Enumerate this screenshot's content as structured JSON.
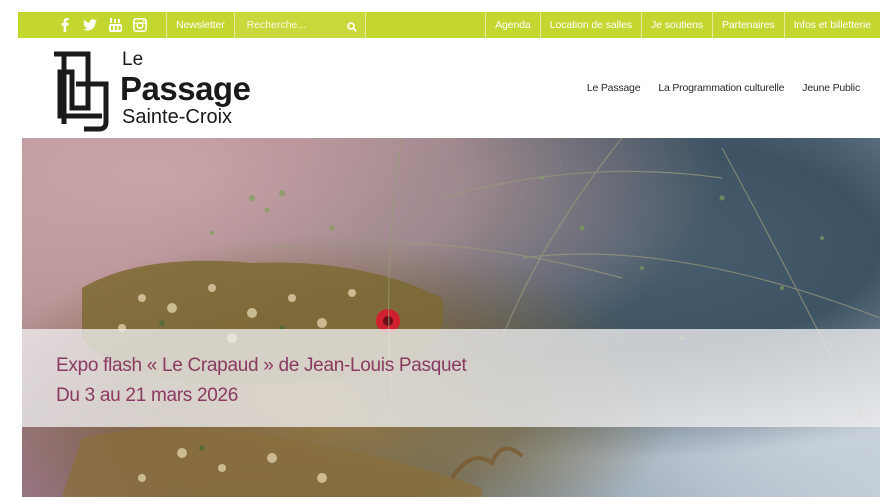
{
  "topbar": {
    "social_icons": [
      "facebook-icon",
      "twitter-icon",
      "youtube-icon",
      "instagram-icon"
    ],
    "newsletter": "Newsletter",
    "search_placeholder": "Recherche...",
    "links": [
      "Agenda",
      "Location de salles",
      "Je soutiens",
      "Partenaires",
      "Infos et billetterie"
    ],
    "bar_color": "#c4d630"
  },
  "logo": {
    "line1": "Le",
    "line2": "Passage",
    "line3": "Sainte-Croix"
  },
  "nav": {
    "items": [
      "Le Passage",
      "La Programmation culturelle",
      "Jeune Public"
    ]
  },
  "hero": {
    "title": "Expo flash « Le Crapaud » de Jean-Louis Pasquet",
    "dates": "Du 3 au 21 mars 2026",
    "text_color": "#8a3a62"
  }
}
